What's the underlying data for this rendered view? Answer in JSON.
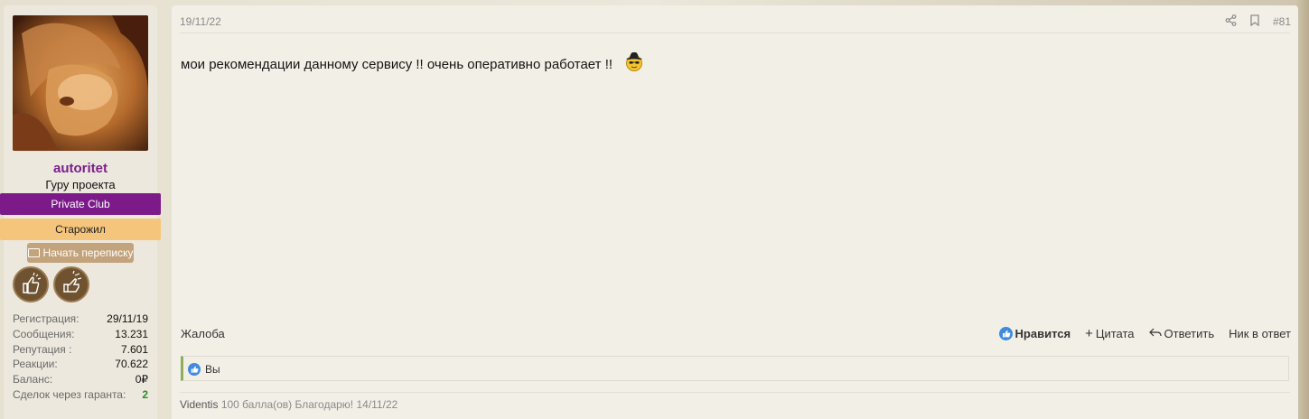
{
  "user": {
    "name": "autoritet",
    "title": "Гуру проекта",
    "banner_private": "Private Club",
    "banner_old": "Старожил",
    "pm_button": "Начать переписку",
    "stats": [
      {
        "label": "Регистрация:",
        "value": "29/11/19"
      },
      {
        "label": "Сообщения:",
        "value": "13.231"
      },
      {
        "label": "Репутация :",
        "value": "7.601"
      },
      {
        "label": "Реакции:",
        "value": "70.622"
      },
      {
        "label": "Баланс:",
        "value": "0₽"
      },
      {
        "label": "Сделок через гаранта:",
        "value": "2"
      }
    ]
  },
  "post": {
    "date": "19/11/22",
    "number": "#81",
    "text": "мои рекомендации данному сервису !! очень оперативно работает !!",
    "complaint": "Жалоба",
    "actions": {
      "like": "Нравится",
      "quote": "Цитата",
      "reply": "Ответить",
      "nick": "Ник в ответ"
    },
    "reactions_text": "Вы",
    "rating": {
      "who": "Videntis",
      "text": "100 балла(ов) Благодарю! 14/11/22"
    }
  },
  "colors": {
    "username": "#7a1e8a",
    "private_banner": "#7b1a88",
    "old_banner": "#f5c57c",
    "like_blue": "#3f8be0"
  },
  "icons": [
    "share-icon",
    "bookmark-icon",
    "envelope-icon",
    "thumbs-up-icon",
    "plus-icon",
    "reply-icon",
    "smiley-hat-icon"
  ]
}
